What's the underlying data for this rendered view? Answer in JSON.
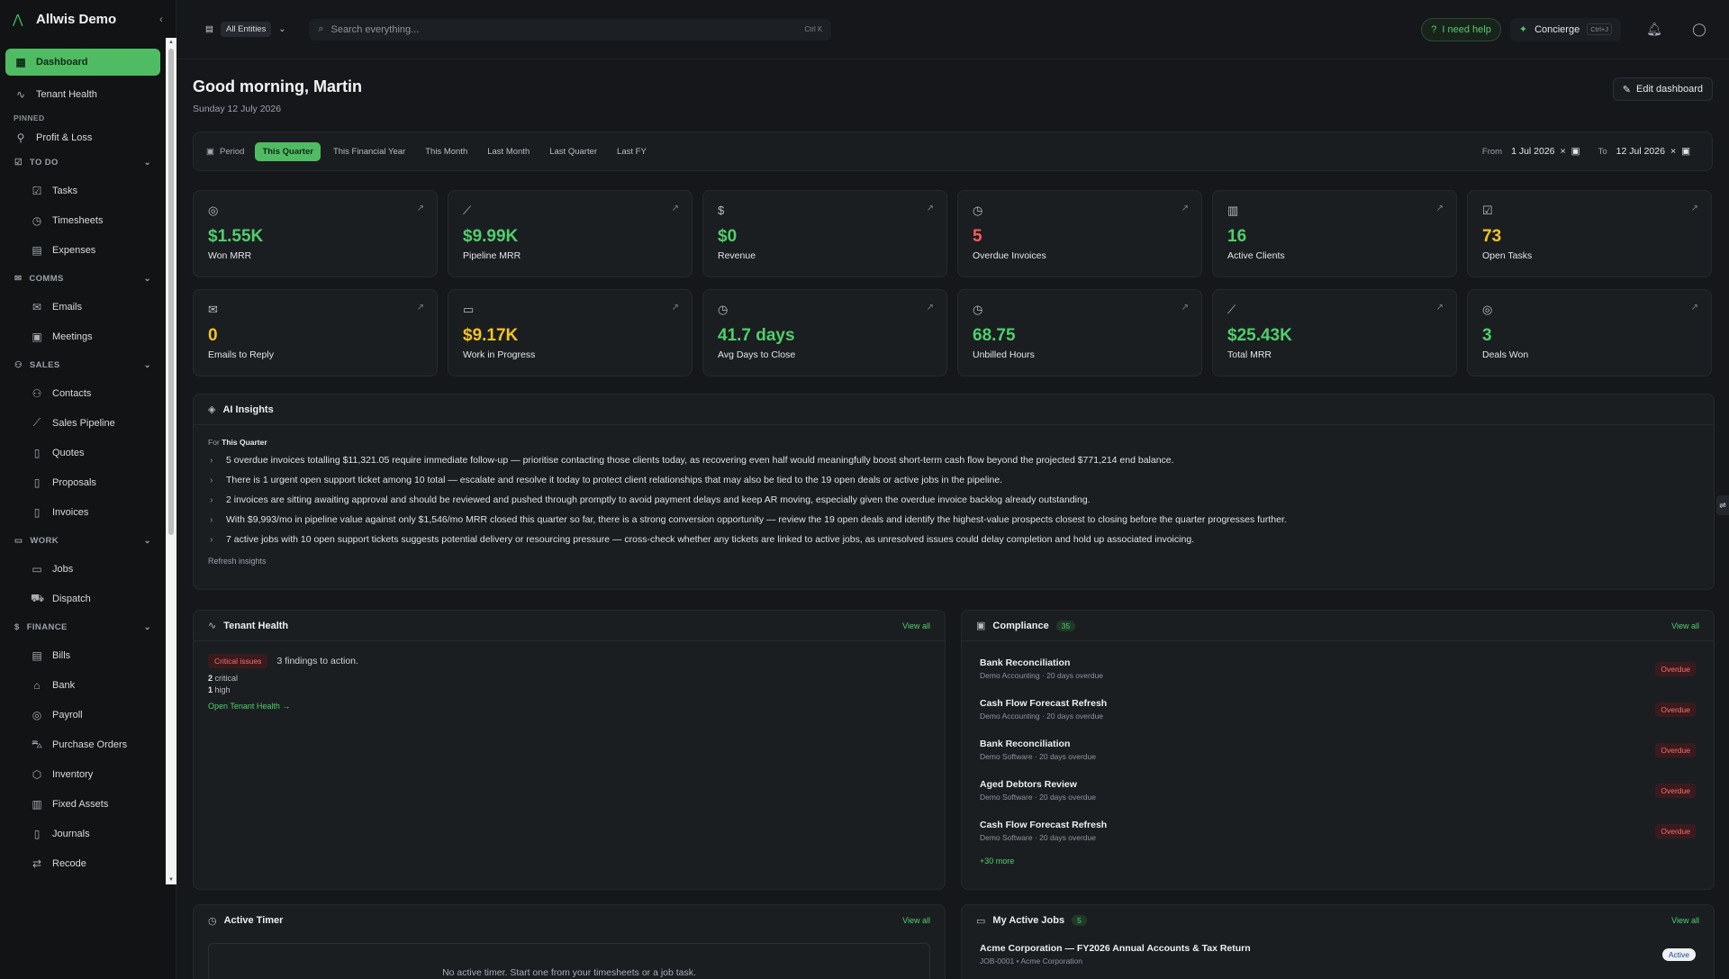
{
  "app": {
    "name": "Allwis Demo"
  },
  "sidebar": {
    "items": [
      {
        "label": "Dashboard",
        "icon": "grid-icon"
      },
      {
        "label": "Tenant Health",
        "icon": "pulse-icon"
      }
    ],
    "pinned_label": "PINNED",
    "pinned": [
      {
        "label": "Profit & Loss",
        "icon": "pin-icon"
      }
    ],
    "groups": [
      {
        "label": "TO DO",
        "icon": "checkbox-icon",
        "items": [
          {
            "label": "Tasks",
            "icon": "task-icon"
          },
          {
            "label": "Timesheets",
            "icon": "clock-icon"
          },
          {
            "label": "Expenses",
            "icon": "receipt-icon"
          }
        ]
      },
      {
        "label": "COMMS",
        "icon": "mail-icon",
        "items": [
          {
            "label": "Emails",
            "icon": "mail-icon"
          },
          {
            "label": "Meetings",
            "icon": "calendar-icon"
          }
        ]
      },
      {
        "label": "SALES",
        "icon": "users-icon",
        "items": [
          {
            "label": "Contacts",
            "icon": "users-icon"
          },
          {
            "label": "Sales Pipeline",
            "icon": "chart-icon"
          },
          {
            "label": "Quotes",
            "icon": "document-icon"
          },
          {
            "label": "Proposals",
            "icon": "document-icon"
          },
          {
            "label": "Invoices",
            "icon": "document-icon"
          }
        ]
      },
      {
        "label": "WORK",
        "icon": "briefcase-icon",
        "items": [
          {
            "label": "Jobs",
            "icon": "briefcase-icon"
          },
          {
            "label": "Dispatch",
            "icon": "truck-icon"
          }
        ]
      },
      {
        "label": "FINANCE",
        "icon": "dollar-icon",
        "items": [
          {
            "label": "Bills",
            "icon": "bill-icon"
          },
          {
            "label": "Bank",
            "icon": "bank-icon"
          },
          {
            "label": "Payroll",
            "icon": "payroll-icon"
          },
          {
            "label": "Purchase Orders",
            "icon": "cart-icon"
          },
          {
            "label": "Inventory",
            "icon": "box-icon"
          },
          {
            "label": "Fixed Assets",
            "icon": "building-icon"
          },
          {
            "label": "Journals",
            "icon": "book-icon"
          },
          {
            "label": "Recode",
            "icon": "swap-icon"
          }
        ]
      }
    ]
  },
  "topbar": {
    "entities": "All Entities",
    "search_placeholder": "Search everything...",
    "search_shortcut": "Ctrl K",
    "help": "I need help",
    "concierge": "Concierge",
    "concierge_shortcut": "Ctrl+J"
  },
  "header": {
    "greeting": "Good morning, Martin",
    "date": "Sunday 12 July 2026",
    "edit": "Edit dashboard"
  },
  "period": {
    "label": "Period",
    "options": [
      "This Quarter",
      "This Financial Year",
      "This Month",
      "Last Month",
      "Last Quarter",
      "Last FY"
    ],
    "from_label": "From",
    "from": "1 Jul 2026",
    "to_label": "To",
    "to": "12 Jul 2026"
  },
  "kpis": [
    {
      "value": "$1.55K",
      "label": "Won MRR",
      "icon": "check-circle-icon",
      "color": "green"
    },
    {
      "value": "$9.99K",
      "label": "Pipeline MRR",
      "icon": "chart-icon",
      "color": "green"
    },
    {
      "value": "$0",
      "label": "Revenue",
      "icon": "dollar-icon",
      "color": "green"
    },
    {
      "value": "5",
      "label": "Overdue Invoices",
      "icon": "alert-icon",
      "color": "red"
    },
    {
      "value": "16",
      "label": "Active Clients",
      "icon": "building-icon",
      "color": "green"
    },
    {
      "value": "73",
      "label": "Open Tasks",
      "icon": "checkbox-icon",
      "color": "yellow"
    },
    {
      "value": "0",
      "label": "Emails to Reply",
      "icon": "mail-icon",
      "color": "yellow"
    },
    {
      "value": "$9.17K",
      "label": "Work in Progress",
      "icon": "briefcase-icon",
      "color": "yellow"
    },
    {
      "value": "41.7 days",
      "label": "Avg Days to Close",
      "icon": "clock-icon",
      "color": "green"
    },
    {
      "value": "68.75",
      "label": "Unbilled Hours",
      "icon": "clock-icon",
      "color": "green"
    },
    {
      "value": "$25.43K",
      "label": "Total MRR",
      "icon": "chart-icon",
      "color": "green"
    },
    {
      "value": "3",
      "label": "Deals Won",
      "icon": "check-circle-icon",
      "color": "green"
    }
  ],
  "insights": {
    "title": "AI Insights",
    "for_label": "For",
    "for_value": "This Quarter",
    "items": [
      "5 overdue invoices totalling $11,321.05 require immediate follow-up — prioritise contacting those clients today, as recovering even half would meaningfully boost short-term cash flow beyond the projected $771,214 end balance.",
      "There is 1 urgent open support ticket among 10 total — escalate and resolve it today to protect client relationships that may also be tied to the 19 open deals or active jobs in the pipeline.",
      "2 invoices are sitting awaiting approval and should be reviewed and pushed through promptly to avoid payment delays and keep AR moving, especially given the overdue invoice backlog already outstanding.",
      "With $9,993/mo in pipeline value against only $1,546/mo MRR closed this quarter so far, there is a strong conversion opportunity — review the 19 open deals and identify the highest-value prospects closest to closing before the quarter progresses further.",
      "7 active jobs with 10 open support tickets suggests potential delivery or resourcing pressure — cross-check whether any tickets are linked to active jobs, as unresolved issues could delay completion and hold up associated invoicing."
    ],
    "refresh": "Refresh insights"
  },
  "tenant": {
    "title": "Tenant Health",
    "view_all": "View all",
    "badge": "Critical issues",
    "summary": "3 findings to action.",
    "critical_count": "2",
    "critical_label": "critical",
    "high_count": "1",
    "high_label": "high",
    "link": "Open Tenant Health →"
  },
  "compliance": {
    "title": "Compliance",
    "count": "35",
    "view_all": "View all",
    "items": [
      {
        "title": "Bank Reconciliation",
        "sub": "Demo Accounting · 20 days overdue",
        "status": "Overdue"
      },
      {
        "title": "Cash Flow Forecast Refresh",
        "sub": "Demo Accounting · 20 days overdue",
        "status": "Overdue"
      },
      {
        "title": "Bank Reconciliation",
        "sub": "Demo Software · 20 days overdue",
        "status": "Overdue"
      },
      {
        "title": "Aged Debtors Review",
        "sub": "Demo Software · 20 days overdue",
        "status": "Overdue"
      },
      {
        "title": "Cash Flow Forecast Refresh",
        "sub": "Demo Software · 20 days overdue",
        "status": "Overdue"
      }
    ],
    "more": "+30 more"
  },
  "timer": {
    "title": "Active Timer",
    "view_all": "View all",
    "empty": "No active timer. Start one from your timesheets or a job task."
  },
  "jobs": {
    "title": "My Active Jobs",
    "count": "5",
    "view_all": "View all",
    "items": [
      {
        "title": "Acme Corporation — FY2026 Annual Accounts & Tax Return",
        "sub": "JOB-0001 • Acme Corporation",
        "status": "Active"
      }
    ]
  },
  "colors": {
    "accent": "#4fbb63",
    "green": "#4fcf6c",
    "red": "#ff5a5a",
    "yellow": "#f5c324",
    "background": "#15171a"
  }
}
